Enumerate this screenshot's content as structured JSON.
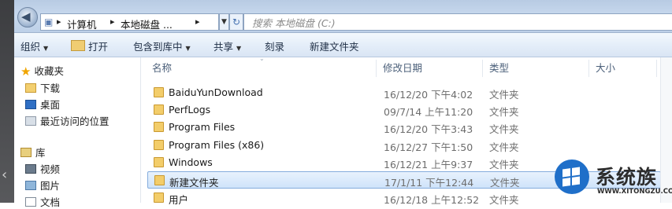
{
  "address": {
    "segments": [
      "计算机",
      "本地磁盘 ..."
    ],
    "search_placeholder": "搜索 本地磁盘 (C:)"
  },
  "toolbar": {
    "organize": "组织",
    "open": "打开",
    "include_in_library": "包含到库中",
    "share": "共享",
    "burn": "刻录",
    "new_folder": "新建文件夹"
  },
  "nav": {
    "favorites": "收藏夹",
    "downloads": "下载",
    "desktop": "桌面",
    "recent": "最近访问的位置",
    "libraries": "库",
    "videos": "视频",
    "pictures": "图片",
    "documents": "文档"
  },
  "columns": {
    "name": "名称",
    "modified": "修改日期",
    "type": "类型",
    "size": "大小"
  },
  "files": [
    {
      "name": "BaiduYunDownload",
      "date": "16/12/20 下午4:02",
      "type": "文件夹"
    },
    {
      "name": "PerfLogs",
      "date": "09/7/14 上午11:20",
      "type": "文件夹"
    },
    {
      "name": "Program Files",
      "date": "16/12/20 下午3:43",
      "type": "文件夹"
    },
    {
      "name": "Program Files (x86)",
      "date": "16/12/27 下午1:50",
      "type": "文件夹"
    },
    {
      "name": "Windows",
      "date": "16/12/21 上午9:37",
      "type": "文件夹"
    },
    {
      "name": "新建文件夹",
      "date": "17/1/11 下午12:44",
      "type": "文件夹",
      "selected": true
    },
    {
      "name": "用户",
      "date": "16/12/18 上午12:52",
      "type": "文件夹"
    }
  ],
  "watermark": {
    "brand": "系统族",
    "url": "WWW.XITONGZU.COM"
  }
}
